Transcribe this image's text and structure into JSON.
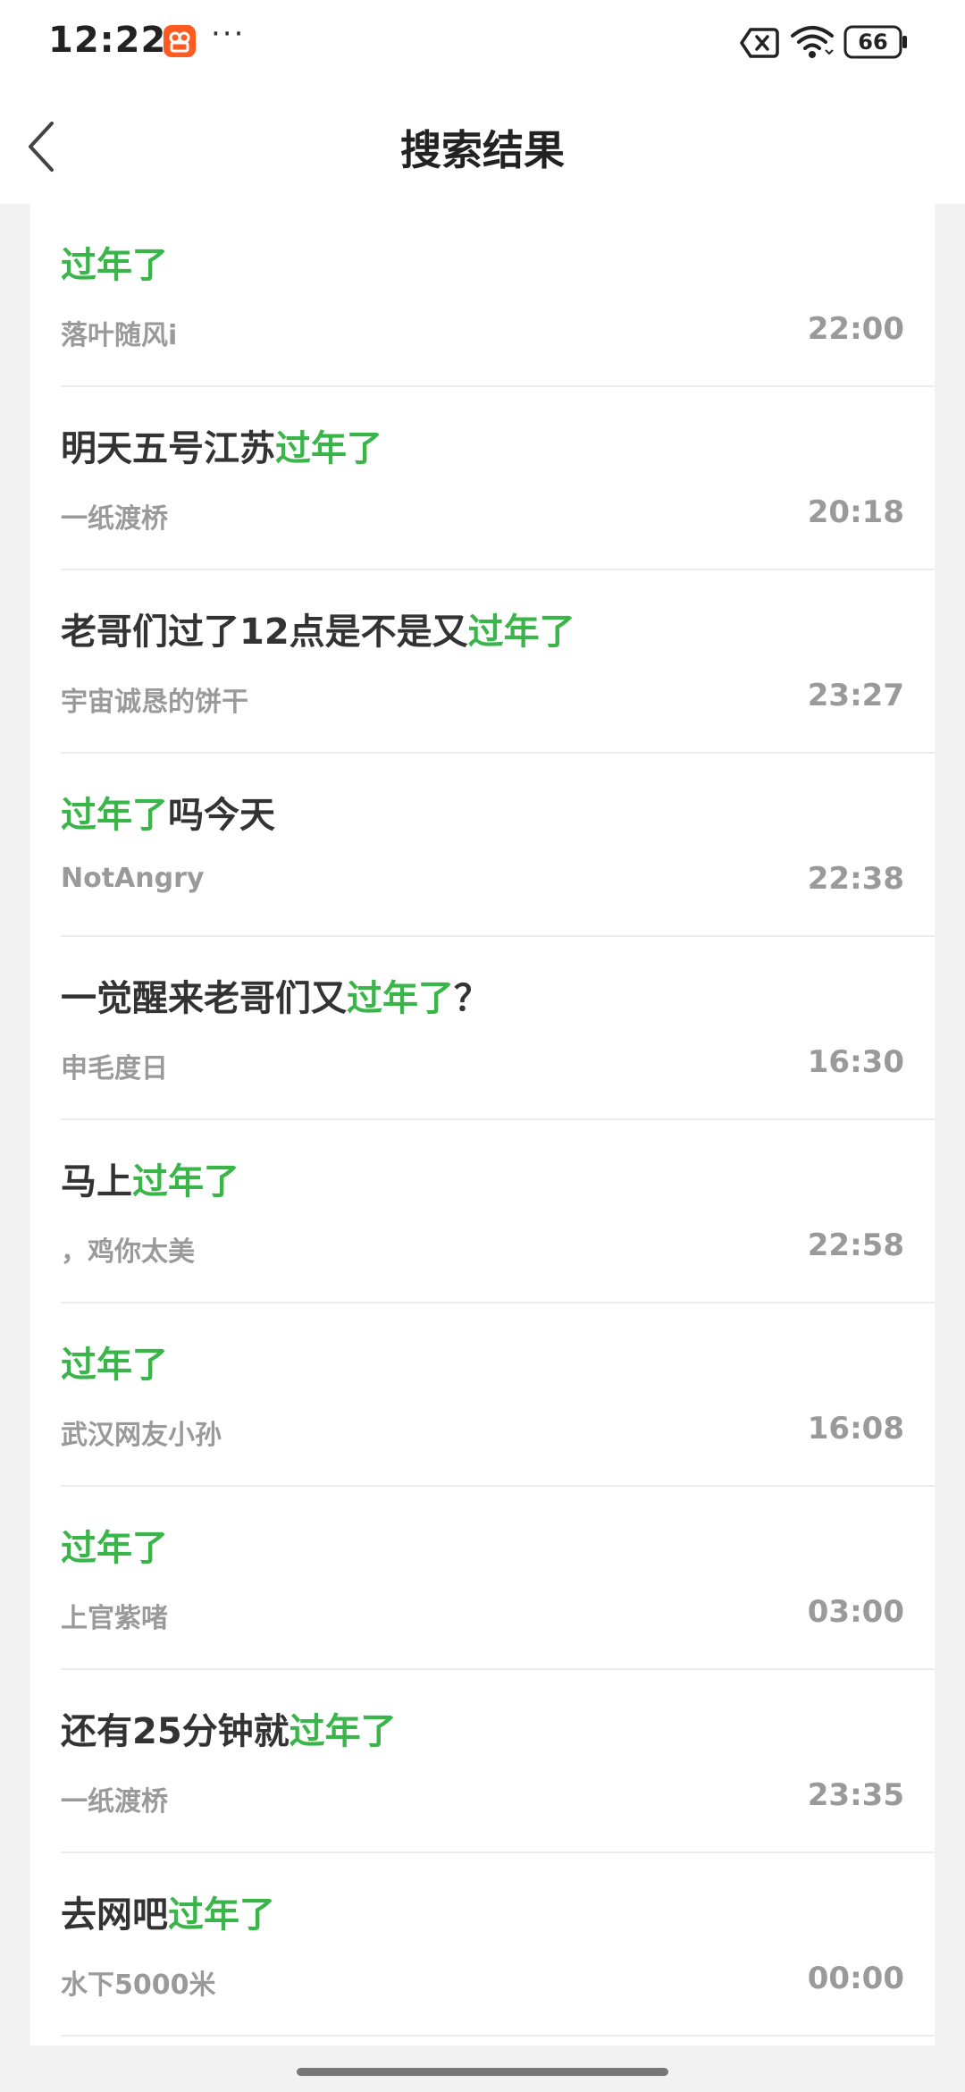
{
  "status_bar": {
    "time": "12:22",
    "dots": "···",
    "battery": "66"
  },
  "header": {
    "title": "搜索结果"
  },
  "results": [
    {
      "title_before": "",
      "title_highlight": "过年了",
      "title_after": "",
      "author": "落叶随风i",
      "time": "22:00"
    },
    {
      "title_before": "明天五号江苏",
      "title_highlight": "过年了",
      "title_after": "",
      "author": "一纸渡桥",
      "time": "20:18"
    },
    {
      "title_before": "老哥们过了12点是不是又",
      "title_highlight": "过年了",
      "title_after": "",
      "author": "宇宙诚恳的饼干",
      "time": "23:27"
    },
    {
      "title_before": "",
      "title_highlight": "过年了",
      "title_after": "吗今天",
      "author": "NotAngry",
      "time": "22:38"
    },
    {
      "title_before": "一觉醒来老哥们又",
      "title_highlight": "过年了",
      "title_after": "？",
      "author": "申毛度日",
      "time": "16:30"
    },
    {
      "title_before": "马上",
      "title_highlight": "过年了",
      "title_after": "",
      "author": "，鸡你太美",
      "time": "22:58"
    },
    {
      "title_before": "",
      "title_highlight": "过年了",
      "title_after": "",
      "author": "武汉网友小孙",
      "time": "16:08"
    },
    {
      "title_before": "",
      "title_highlight": "过年了",
      "title_after": "",
      "author": "上官紫啫",
      "time": "03:00"
    },
    {
      "title_before": "还有25分钟就",
      "title_highlight": "过年了",
      "title_after": "",
      "author": "一纸渡桥",
      "time": "23:35"
    },
    {
      "title_before": "去网吧",
      "title_highlight": "过年了",
      "title_after": "",
      "author": "水下5000米",
      "time": "00:00"
    }
  ],
  "colors": {
    "highlight": "#3ab54a",
    "title_text": "#333333",
    "meta_text": "#9a9a9a",
    "app_badge": "#ff5a1f"
  }
}
